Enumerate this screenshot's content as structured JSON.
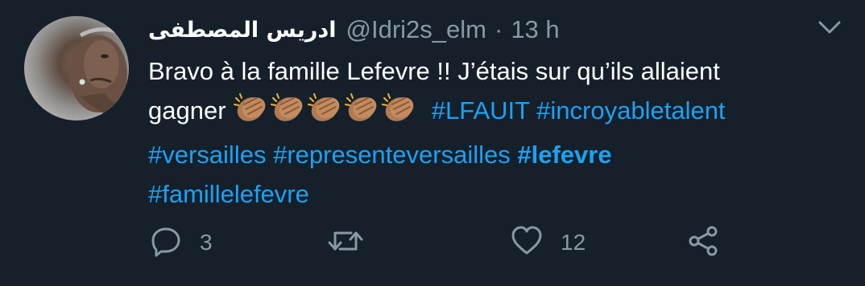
{
  "tweet": {
    "display_name": "ادريس المصطفى",
    "handle": "@Idri2s_elm",
    "separator": "·",
    "time": "13 h",
    "text_line1": "Bravo à la famille Lefevre !! J’étais sur qu’ils allaient",
    "text_gagner": "gagner",
    "emoji": "clapping-hands-medium-skin-tone x5",
    "hashtags": {
      "h1": "#LFAUIT",
      "h2": "#incroyabletalent",
      "h3": "#versailles",
      "h4": "#representeversailles",
      "h5": "#lefevre",
      "h6": "#famillelefevre"
    }
  },
  "actions": {
    "reply_icon": "reply-icon",
    "reply_count": "3",
    "retweet_icon": "retweet-icon",
    "like_icon": "heart-icon",
    "like_count": "12",
    "share_icon": "share-icon"
  },
  "colors": {
    "background": "#15202b",
    "text": "#ffffff",
    "muted": "#8899a6",
    "link": "#1da1f2"
  }
}
